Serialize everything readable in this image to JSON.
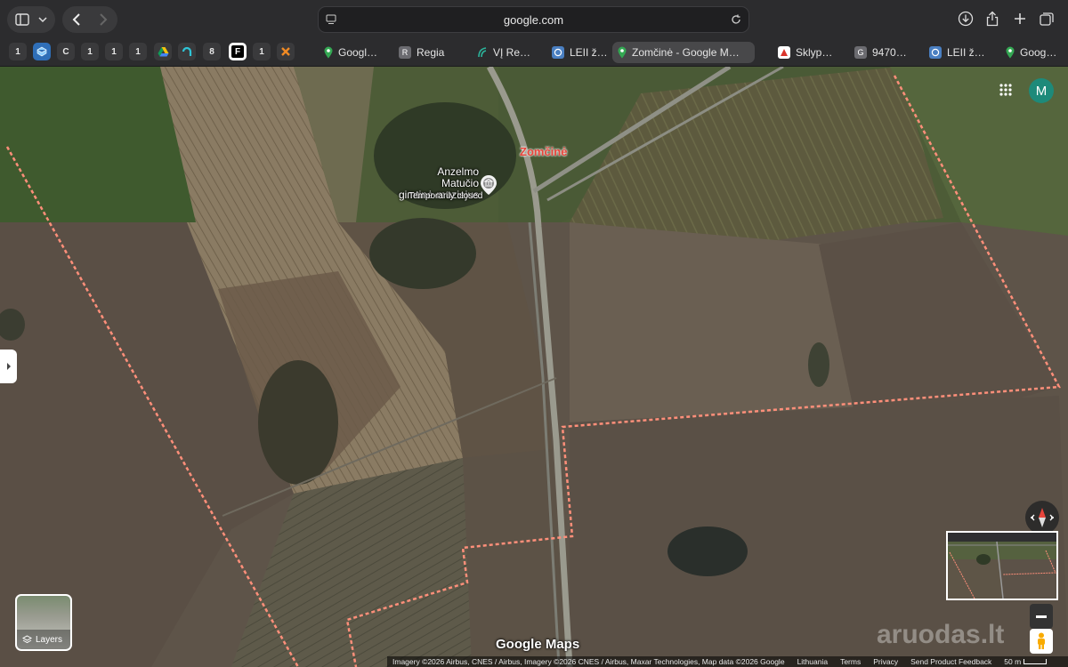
{
  "browser": {
    "url": "google.com",
    "pinned_tabs": [
      "1",
      "",
      "C",
      "1",
      "1",
      "1",
      "",
      "",
      "8",
      "F",
      "1",
      ""
    ],
    "tabs": [
      {
        "label": "Googl…",
        "icon": "maps-pin-icon"
      },
      {
        "label": "Regia",
        "icon": "regia-icon",
        "favtext": "R"
      },
      {
        "label": "VĮ Re…",
        "icon": "registras-icon"
      },
      {
        "label": "LEII ž…",
        "icon": "map-layers-icon"
      },
      {
        "label": "Zomčinė - Google M…",
        "icon": "maps-pin-icon",
        "active": true
      },
      {
        "label": "Sklyp…",
        "icon": "aruodas-icon"
      },
      {
        "label": "9470…",
        "icon": "g-icon",
        "favtext": "G"
      },
      {
        "label": "LEII ž…",
        "icon": "map-layers-icon"
      },
      {
        "label": "Goog…",
        "icon": "maps-pin-icon"
      }
    ]
  },
  "map": {
    "place_label": "Zomčinė",
    "poi": {
      "name_line1": "Anzelmo Matučio",
      "name_line2": "gimtinė-muziejus",
      "status": "Temporarily closed"
    },
    "account_initial": "M",
    "layers_label": "Layers",
    "google_maps": "Google Maps",
    "watermark": "aruodas.lt",
    "footer": {
      "imagery": "Imagery ©2026 Airbus, CNES / Airbus, Imagery ©2026 CNES / Airbus, Maxar Technologies, Map data ©2026 Google",
      "country": "Lithuania",
      "terms": "Terms",
      "privacy": "Privacy",
      "feedback": "Send Product Feedback",
      "scale": "50 m"
    },
    "colors": {
      "boundary": "#ff8f7a",
      "place_label": "#e8453c",
      "accent_teal": "#1e8a7a"
    }
  }
}
